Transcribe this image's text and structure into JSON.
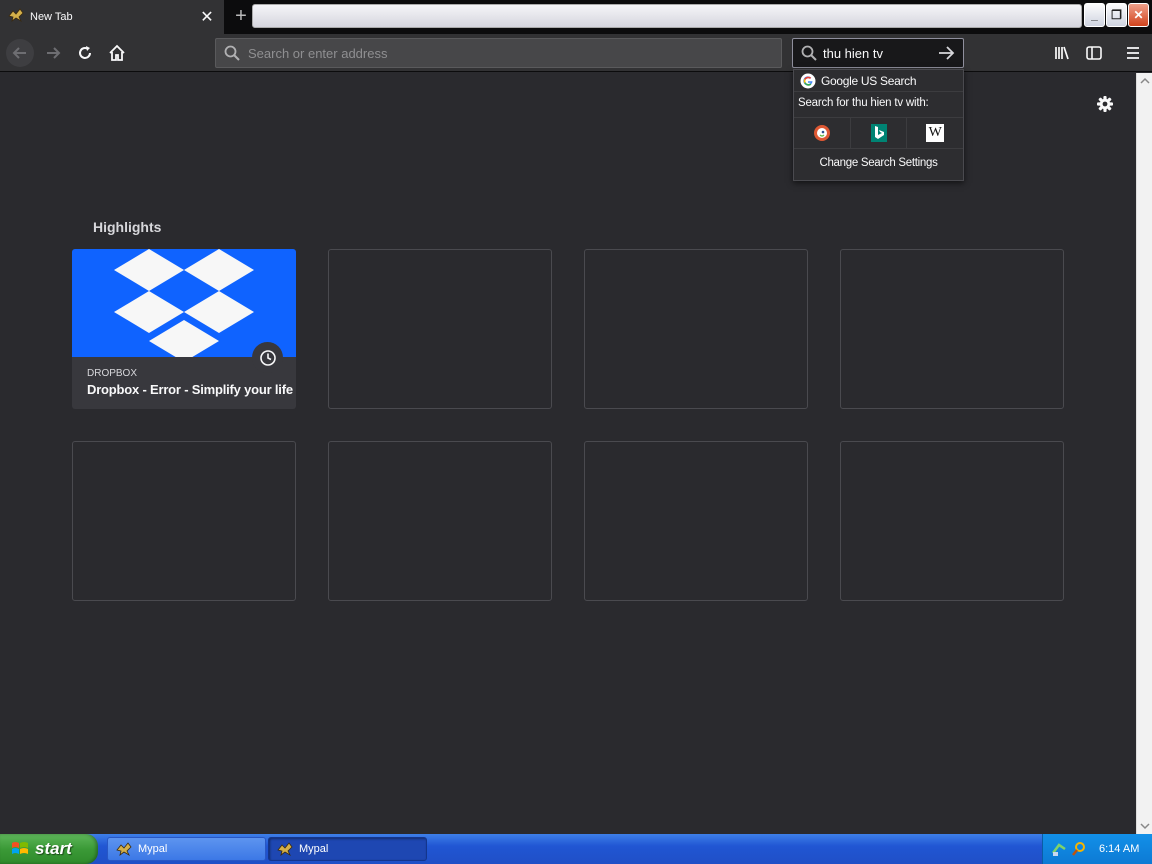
{
  "browser": {
    "tab": {
      "title": "New Tab",
      "close_glyph": "✕"
    },
    "new_tab_glyph": "+",
    "window_buttons": {
      "minimize": "_",
      "restore": "❐",
      "close": "✕"
    }
  },
  "navbar": {
    "url_placeholder": "Search or enter address",
    "search_value": "thu hien tv"
  },
  "search_popup": {
    "engine": "Google US Search",
    "search_with": "Search for thu hien tv with:",
    "alt_engines": [
      "duckduckgo-icon",
      "bing-icon",
      "wikipedia-icon"
    ],
    "wikipedia_glyph": "W",
    "change_settings": "Change Search Settings"
  },
  "content": {
    "highlights_title": "Highlights",
    "cards": [
      {
        "host": "DROPBOX",
        "title": "Dropbox - Error - Simplify your life"
      }
    ]
  },
  "taskbar": {
    "start_label": "start",
    "tasks": [
      {
        "label": "Mypal",
        "active": false
      },
      {
        "label": "Mypal",
        "active": true
      }
    ],
    "time": "6:14 AM"
  },
  "colors": {
    "page_bg": "#2a2a2e",
    "dropbox_blue": "#0f63ff",
    "toolbar": "#323234"
  }
}
